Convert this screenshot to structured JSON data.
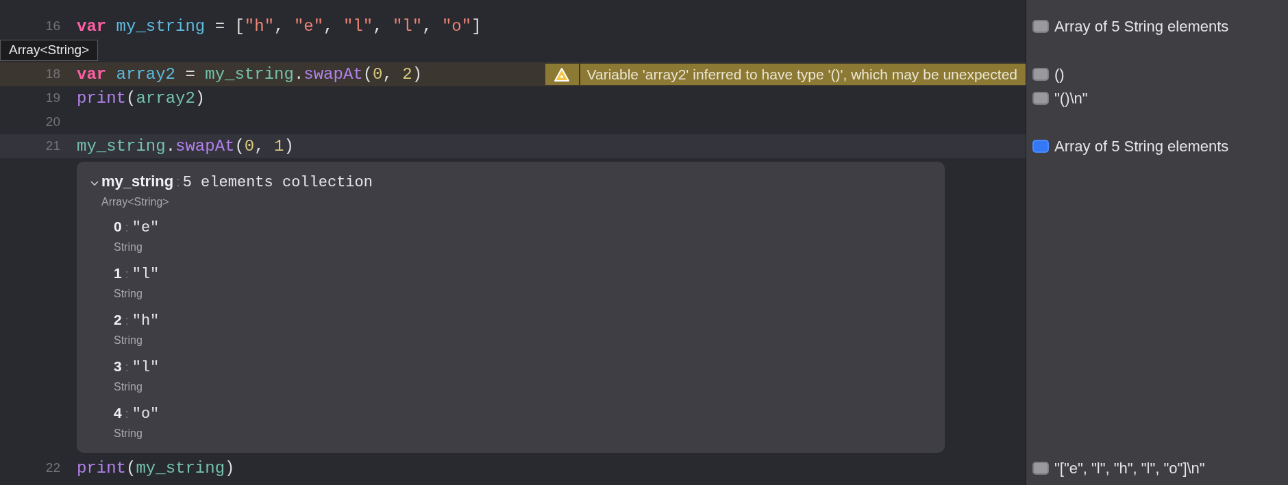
{
  "rows": [
    {
      "kind": "code",
      "number": "16",
      "current": false,
      "tokens": [
        {
          "kind": "keyword",
          "text": "var "
        },
        {
          "kind": "declaration",
          "text": "my_string"
        },
        {
          "kind": "plain",
          "text": " = ["
        },
        {
          "kind": "string",
          "text": "\"h\""
        },
        {
          "kind": "plain",
          "text": ", "
        },
        {
          "kind": "string",
          "text": "\"e\""
        },
        {
          "kind": "plain",
          "text": ", "
        },
        {
          "kind": "string",
          "text": "\"l\""
        },
        {
          "kind": "plain",
          "text": ", "
        },
        {
          "kind": "string",
          "text": "\"l\""
        },
        {
          "kind": "plain",
          "text": ", "
        },
        {
          "kind": "string",
          "text": "\"o\""
        },
        {
          "kind": "plain",
          "text": "]"
        }
      ],
      "result": {
        "text": "Array of 5 String elements",
        "selected": false
      }
    },
    {
      "kind": "tooltip",
      "text": "Array<String>"
    },
    {
      "kind": "code",
      "number": "18",
      "current": false,
      "tokens": [
        {
          "kind": "keyword",
          "text": "var "
        },
        {
          "kind": "declaration",
          "text": "array2"
        },
        {
          "kind": "plain",
          "text": " = "
        },
        {
          "kind": "identifier",
          "text": "my_string"
        },
        {
          "kind": "plain",
          "text": "."
        },
        {
          "kind": "function",
          "text": "swapAt"
        },
        {
          "kind": "plain",
          "text": "("
        },
        {
          "kind": "number",
          "text": "0"
        },
        {
          "kind": "plain",
          "text": ", "
        },
        {
          "kind": "number",
          "text": "2"
        },
        {
          "kind": "plain",
          "text": ")"
        }
      ],
      "warning": "Variable 'array2' inferred to have type '()', which may be unexpected",
      "result": {
        "text": "()",
        "selected": false
      }
    },
    {
      "kind": "code",
      "number": "19",
      "current": false,
      "tokens": [
        {
          "kind": "function",
          "text": "print"
        },
        {
          "kind": "plain",
          "text": "("
        },
        {
          "kind": "identifier",
          "text": "array2"
        },
        {
          "kind": "plain",
          "text": ")"
        }
      ],
      "result": {
        "text": "\"()\\n\"",
        "selected": false
      }
    },
    {
      "kind": "code",
      "number": "20",
      "current": false,
      "tokens": []
    },
    {
      "kind": "code",
      "number": "21",
      "current": true,
      "tokens": [
        {
          "kind": "identifier",
          "text": "my_string"
        },
        {
          "kind": "plain",
          "text": "."
        },
        {
          "kind": "function",
          "text": "swapAt"
        },
        {
          "kind": "plain",
          "text": "("
        },
        {
          "kind": "number",
          "text": "0"
        },
        {
          "kind": "plain",
          "text": ", "
        },
        {
          "kind": "number",
          "text": "1"
        },
        {
          "kind": "plain",
          "text": ")"
        }
      ],
      "result": {
        "text": "Array of 5 String elements",
        "selected": true
      }
    },
    {
      "kind": "inspector",
      "expanded": true,
      "name": "my_string",
      "separator": ":",
      "summary": "5 elements collection",
      "type": "Array<String>",
      "items": [
        {
          "index": "0",
          "separator": ":",
          "value": "\"e\"",
          "type": "String"
        },
        {
          "index": "1",
          "separator": ":",
          "value": "\"l\"",
          "type": "String"
        },
        {
          "index": "2",
          "separator": ":",
          "value": "\"h\"",
          "type": "String"
        },
        {
          "index": "3",
          "separator": ":",
          "value": "\"l\"",
          "type": "String"
        },
        {
          "index": "4",
          "separator": ":",
          "value": "\"o\"",
          "type": "String"
        }
      ]
    },
    {
      "kind": "code",
      "number": "22",
      "current": false,
      "tokens": [
        {
          "kind": "function",
          "text": "print"
        },
        {
          "kind": "plain",
          "text": "("
        },
        {
          "kind": "identifier",
          "text": "my_string"
        },
        {
          "kind": "plain",
          "text": ")"
        }
      ],
      "result": {
        "text": "\"[\"e\", \"l\", \"h\", \"l\", \"o\"]\\n\"",
        "selected": false
      }
    }
  ]
}
